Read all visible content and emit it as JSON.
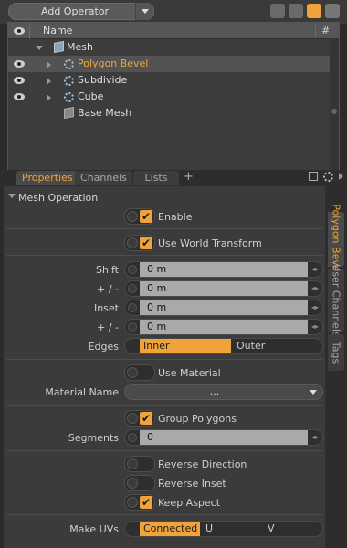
{
  "toolbar": {
    "add_operator_label": "Add Operator"
  },
  "tree": {
    "columns": {
      "name": "Name",
      "hash": "#"
    },
    "items": [
      {
        "label": "Mesh",
        "visible": false,
        "expanded": true,
        "icon": "mesh-cube-icon"
      },
      {
        "label": "Polygon Bevel",
        "visible": true,
        "selected": true,
        "icon": "gear-icon"
      },
      {
        "label": "Subdivide",
        "visible": true,
        "icon": "gear-icon"
      },
      {
        "label": "Cube",
        "visible": true,
        "icon": "gear-icon"
      },
      {
        "label": "Base Mesh",
        "visible": false,
        "icon": "base-mesh-icon"
      }
    ]
  },
  "tabs": {
    "properties": "Properties",
    "channels": "Channels",
    "lists": "Lists",
    "add": "+"
  },
  "side_tabs": {
    "polygon_bevel": "Polygon Bevel",
    "user_channels": "User Channels",
    "tags": "Tags"
  },
  "section": {
    "title": "Mesh Operation"
  },
  "props": {
    "enable": {
      "label": "Enable",
      "checked": true
    },
    "world_transform": {
      "label": "Use World Transform",
      "checked": true
    },
    "shift": {
      "label": "Shift",
      "value": "0 m"
    },
    "shift_pm": {
      "label": "+ / -",
      "value": "0 m"
    },
    "inset": {
      "label": "Inset",
      "value": "0 m"
    },
    "inset_pm": {
      "label": "+ / -",
      "value": "0 m"
    },
    "edges": {
      "label": "Edges",
      "options": [
        "Inner",
        "Outer"
      ],
      "selected": "Inner"
    },
    "use_material": {
      "label": "Use Material",
      "checked": false
    },
    "material_name": {
      "label": "Material Name",
      "value": "..."
    },
    "group_polygons": {
      "label": "Group Polygons",
      "checked": true
    },
    "segments": {
      "label": "Segments",
      "value": "0"
    },
    "reverse_direction": {
      "label": "Reverse Direction",
      "checked": false
    },
    "reverse_inset": {
      "label": "Reverse Inset",
      "checked": false
    },
    "keep_aspect": {
      "label": "Keep Aspect",
      "checked": true
    },
    "make_uvs": {
      "label": "Make UVs",
      "options": [
        "Connected",
        "U",
        "V"
      ],
      "selected": "Connected"
    }
  },
  "colors": {
    "accent": "#f0a33b",
    "panel": "#3b3b3b"
  },
  "checkmark": "✔",
  "arrows": "◂▸"
}
